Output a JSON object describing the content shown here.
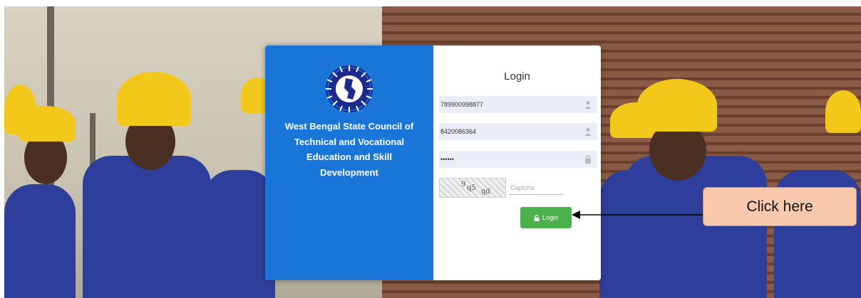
{
  "brand": {
    "org_name": "West Bengal State Council of Technical and Vocational Education and Skill Development",
    "logo_icon": "wbsctvesd-emblem-icon",
    "panel_color": "#1a75d8"
  },
  "login": {
    "title": "Login",
    "username_value": "789900998877",
    "mobile_value": "8420086364",
    "password_value": "••••••",
    "captcha_text": [
      "9",
      "q5",
      "qd"
    ],
    "captcha_placeholder": "Captcha",
    "button_label": "Login",
    "button_color": "#4bb24b"
  },
  "annotation": {
    "callout_text": "Click here"
  }
}
